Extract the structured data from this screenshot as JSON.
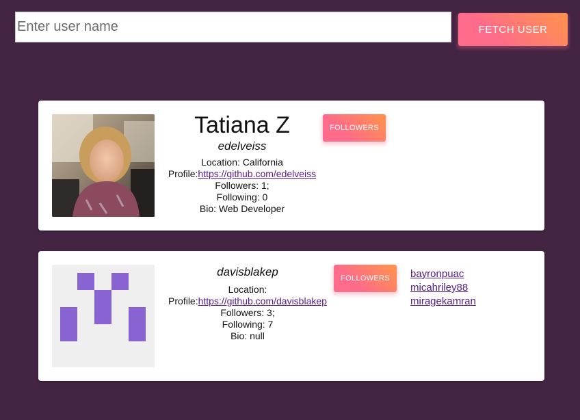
{
  "search": {
    "placeholder": "Enter user name",
    "value": "",
    "button_label": "FETCH USER"
  },
  "users": [
    {
      "name": "Tatiana Z",
      "login": "edelveiss",
      "location_label": "Location: California",
      "profile_prefix": "Profile:",
      "profile_url": "https://github.com/edelveiss",
      "followers_label": "Followers: 1;",
      "following_label": "Following: 0",
      "bio_label": "Bio: Web Developer",
      "followers_button_label": "FOLLOWERS",
      "avatar": "photo-avatar",
      "follower_links": []
    },
    {
      "name": "",
      "login": "davisblakep",
      "location_label": "Location:",
      "profile_prefix": "Profile:",
      "profile_url": "https://github.com/davisblakep",
      "followers_label": "Followers: 3;",
      "following_label": "Following: 7",
      "bio_label": "Bio: null",
      "followers_button_label": "FOLLOWERS",
      "avatar": "identicon-avatar",
      "follower_links": [
        "bayronpuac",
        "micahriley88",
        "miragekamran"
      ]
    }
  ],
  "colors": {
    "background": "#432443",
    "button_gradient_start": "#fe6b8b",
    "button_gradient_end": "#ff8e53",
    "link": "#551a8b",
    "identicon": "#8a63d2"
  }
}
